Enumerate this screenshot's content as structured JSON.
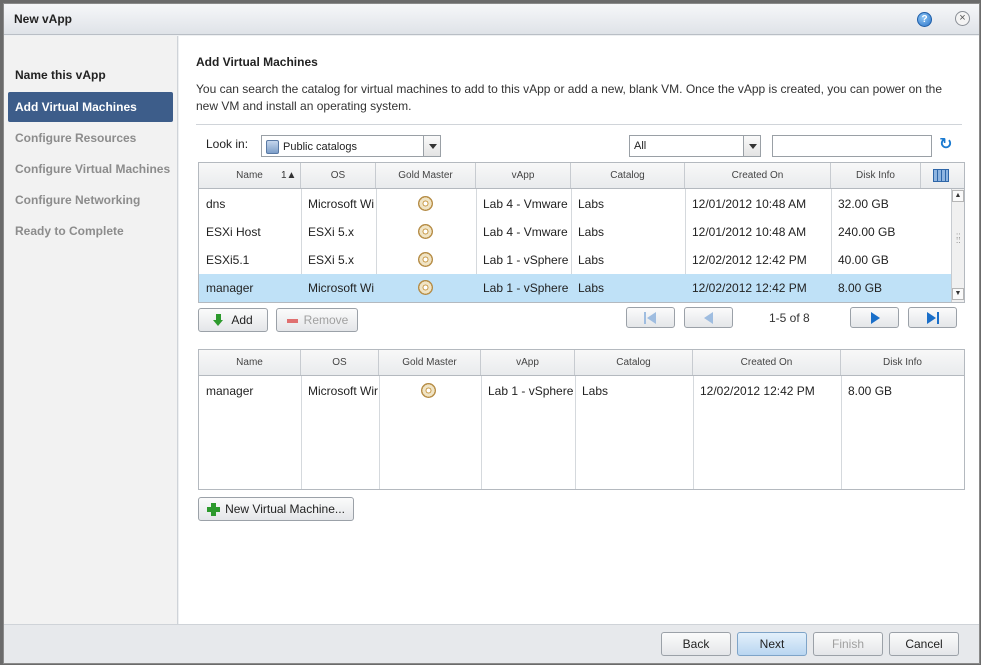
{
  "window": {
    "title": "New vApp"
  },
  "sidebar": {
    "steps": [
      {
        "label": "Name this vApp",
        "state": "done"
      },
      {
        "label": "Add Virtual Machines",
        "state": "active"
      },
      {
        "label": "Configure Resources",
        "state": "pending"
      },
      {
        "label": "Configure Virtual Machines",
        "state": "pending"
      },
      {
        "label": "Configure Networking",
        "state": "pending"
      },
      {
        "label": "Ready to Complete",
        "state": "pending"
      }
    ]
  },
  "main": {
    "heading": "Add Virtual Machines",
    "description": "You can search the catalog for virtual machines to add to this vApp or add a new, blank VM. Once the vApp is created, you can power on the new VM and install an operating system.",
    "look_in_label": "Look in:",
    "look_in_value": "Public catalogs",
    "filter_value": "All",
    "search_value": ""
  },
  "catalog_grid": {
    "columns": [
      "Name",
      "OS",
      "Gold Master",
      "vApp",
      "Catalog",
      "Created On",
      "Disk Info"
    ],
    "sort_indicator": "1▲",
    "rows": [
      {
        "name": "dns",
        "os": "Microsoft Wi",
        "vapp": "Lab 4 - Vmware",
        "catalog": "Labs",
        "created": "12/01/2012 10:48 AM",
        "disk": "32.00 GB",
        "selected": false
      },
      {
        "name": "ESXi Host",
        "os": "ESXi 5.x",
        "vapp": "Lab 4 - Vmware",
        "catalog": "Labs",
        "created": "12/01/2012 10:48 AM",
        "disk": "240.00 GB",
        "selected": false
      },
      {
        "name": "ESXi5.1",
        "os": "ESXi 5.x",
        "vapp": "Lab 1 - vSphere",
        "catalog": "Labs",
        "created": "12/02/2012 12:42 PM",
        "disk": "40.00 GB",
        "selected": false
      },
      {
        "name": "manager",
        "os": "Microsoft Wi",
        "vapp": "Lab 1 - vSphere",
        "catalog": "Labs",
        "created": "12/02/2012 12:42 PM",
        "disk": "8.00 GB",
        "selected": true
      }
    ]
  },
  "actions": {
    "add_label": "Add",
    "remove_label": "Remove"
  },
  "pager": {
    "text": "1-5 of 8"
  },
  "selected_grid": {
    "columns": [
      "Name",
      "OS",
      "Gold Master",
      "vApp",
      "Catalog",
      "Created On",
      "Disk Info"
    ],
    "rows": [
      {
        "name": "manager",
        "os": "Microsoft Wir",
        "vapp": "Lab 1 - vSphere",
        "catalog": "Labs",
        "created": "12/02/2012 12:42 PM",
        "disk": "8.00 GB"
      }
    ]
  },
  "new_vm_label": "New Virtual Machine...",
  "footer": {
    "back_label": "Back",
    "next_label": "Next",
    "finish_label": "Finish",
    "cancel_label": "Cancel"
  }
}
